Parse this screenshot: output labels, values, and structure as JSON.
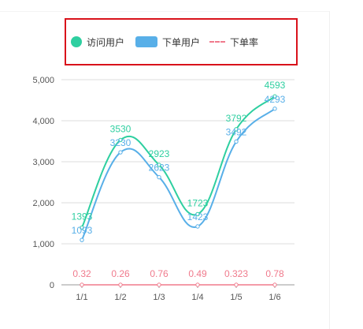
{
  "chart_data": {
    "type": "line",
    "categories": [
      "1/1",
      "1/2",
      "1/3",
      "1/4",
      "1/5",
      "1/6"
    ],
    "ylim": [
      0,
      5000
    ],
    "yticks": [
      "0",
      "1,000",
      "2,000",
      "3,000",
      "4,000",
      "5,000"
    ],
    "grid": true,
    "legend_position": "top",
    "series": [
      {
        "name": "访问用户",
        "values": [
          1393,
          3530,
          2923,
          1723,
          3792,
          4593
        ],
        "color": "#2ecfa0",
        "marker": "circle",
        "smooth": true
      },
      {
        "name": "下单用户",
        "values": [
          1093,
          3230,
          2623,
          1423,
          3492,
          4293
        ],
        "color": "#58afe8",
        "marker": "rect",
        "smooth": true
      },
      {
        "name": "下单率",
        "values": [
          0.32,
          0.26,
          0.76,
          0.49,
          0.323,
          0.78
        ],
        "labels": [
          "0.32",
          "0.26",
          "0.76",
          "0.49",
          "0.323",
          "0.78"
        ],
        "color": "#f07a8c",
        "marker": "dash",
        "smooth": false
      }
    ]
  }
}
